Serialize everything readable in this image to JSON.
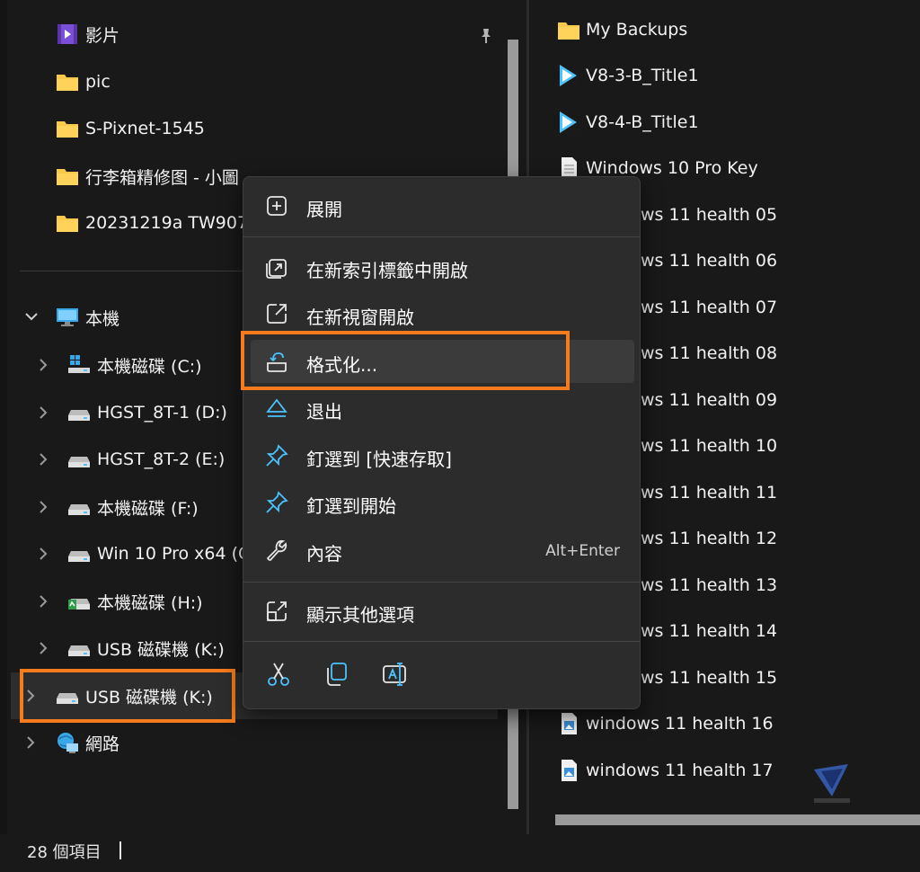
{
  "quick_access": [
    {
      "label": "影片",
      "icon": "video-folder-icon"
    },
    {
      "label": "pic",
      "icon": "folder-icon"
    },
    {
      "label": "S-Pixnet-1545",
      "icon": "folder-icon"
    },
    {
      "label": "行李箱精修图 - 小圖",
      "icon": "folder-icon"
    },
    {
      "label": "20231219a TW9071",
      "icon": "folder-icon"
    }
  ],
  "this_pc": {
    "label": "本機",
    "icon": "computer-icon"
  },
  "drives": [
    {
      "label": "本機磁碟 (C:)",
      "icon": "windows-drive-icon"
    },
    {
      "label": "HGST_8T-1 (D:)",
      "icon": "drive-icon"
    },
    {
      "label": "HGST_8T-2 (E:)",
      "icon": "drive-icon"
    },
    {
      "label": "本機磁碟 (F:)",
      "icon": "drive-icon"
    },
    {
      "label": "Win 10 Pro x64 (G",
      "icon": "drive-icon"
    },
    {
      "label": "本機磁碟 (H:)",
      "icon": "drive-icon"
    },
    {
      "label": "USB 磁碟機 (K:)",
      "icon": "usb-drive-icon"
    }
  ],
  "selected_drive": {
    "label": "USB 磁碟機 (K:)",
    "icon": "usb-drive-icon"
  },
  "network": {
    "label": "網路",
    "icon": "network-icon"
  },
  "files": [
    {
      "label": "My Backups",
      "icon": "folder-icon"
    },
    {
      "label": "V8-3-B_Title1",
      "icon": "video-file-icon"
    },
    {
      "label": "V8-4-B_Title1",
      "icon": "video-file-icon"
    },
    {
      "label": "Windows 10 Pro Key",
      "icon": "text-file-icon"
    },
    {
      "label": "ws 11 health 05",
      "icon": ""
    },
    {
      "label": "ws 11 health 06",
      "icon": ""
    },
    {
      "label": "ws 11 health 07",
      "icon": ""
    },
    {
      "label": "ws 11 health 08",
      "icon": ""
    },
    {
      "label": "ws 11 health 09",
      "icon": ""
    },
    {
      "label": "ws 11 health 10",
      "icon": ""
    },
    {
      "label": "ws 11 health 11",
      "icon": ""
    },
    {
      "label": "ws 11 health 12",
      "icon": ""
    },
    {
      "label": "ws 11 health 13",
      "icon": ""
    },
    {
      "label": "ws 11 health 14",
      "icon": ""
    },
    {
      "label": "ws 11 health 15",
      "icon": ""
    },
    {
      "label": "windows 11 health 16",
      "icon": "image-file-icon"
    },
    {
      "label": "windows 11 health 17",
      "icon": "image-file-icon"
    }
  ],
  "context_menu": {
    "expand": "展開",
    "open_new_tab": "在新索引標籤中開啟",
    "open_new_window": "在新視窗開啟",
    "format": "格式化...",
    "eject": "退出",
    "pin_quick_access": "釘選到 [快速存取]",
    "pin_start": "釘選到開始",
    "properties": "內容",
    "properties_shortcut": "Alt+Enter",
    "show_more": "顯示其他選項"
  },
  "status": {
    "item_count": "28 個項目"
  },
  "colors": {
    "highlight": "#f57b1c",
    "accent": "#4cc2ff",
    "folder": "#f8c94a"
  }
}
